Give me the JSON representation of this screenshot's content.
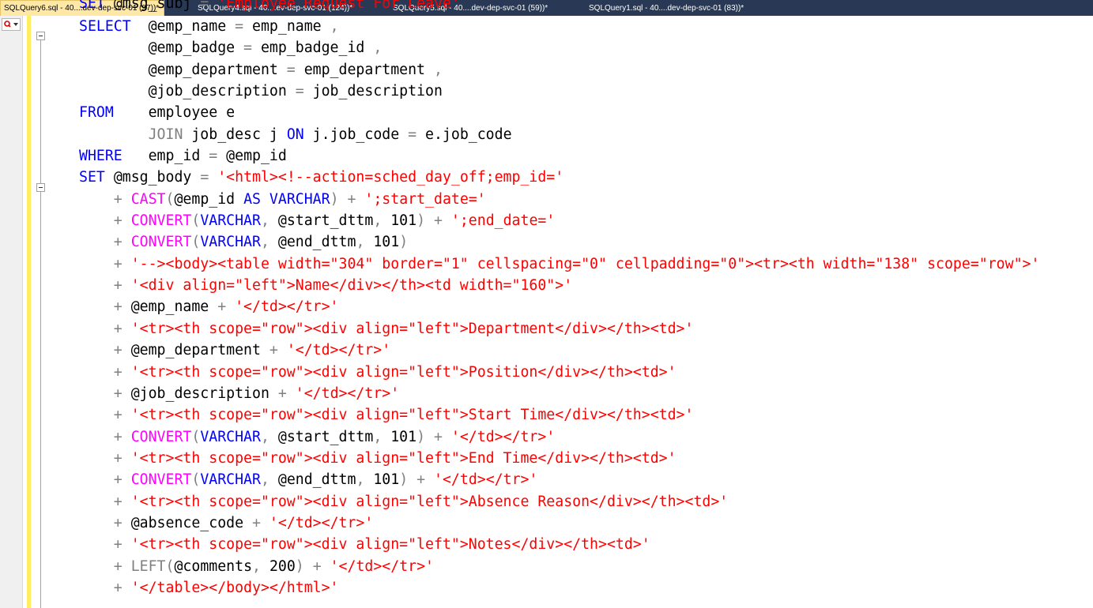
{
  "tabs": [
    {
      "label": "SQLQuery6.sql - 40....dev-dep-svc-01 (97))*",
      "active": true
    },
    {
      "label": "SQLQuery4.sql - 40....ev-dep-svc-01 (124))*",
      "active": false
    },
    {
      "label": "SQLQuery5.sql - 40....dev-dep-svc-01 (59))*",
      "active": false
    },
    {
      "label": "SQLQuery1.sql - 40....dev-dep-svc-01 (83))*",
      "active": false
    }
  ],
  "colors": {
    "keyword": "#0000ff",
    "function": "#ff00ff",
    "string": "#ff0000",
    "operator": "#808080",
    "identifier": "#000000",
    "tab_strip": "#293955",
    "active_tab": "#ffe8a6",
    "change_bar": "#ffee62"
  },
  "icons": {
    "navigation": "navigation-dropdown-icon",
    "fold": "collapse-minus-icon"
  },
  "editor": {
    "partial_top_line": [
      [
        "kw",
        "SET "
      ],
      [
        "id",
        "@msg_subj "
      ],
      [
        "op",
        "= "
      ],
      [
        "str",
        "'Employee Request For Leave'"
      ]
    ],
    "lines": [
      [
        [
          "kw",
          "SELECT  "
        ],
        [
          "id",
          "@emp_name "
        ],
        [
          "op",
          "= "
        ],
        [
          "id",
          "emp_name "
        ],
        [
          "op",
          ","
        ]
      ],
      [
        [
          "id",
          "        @emp_badge "
        ],
        [
          "op",
          "= "
        ],
        [
          "id",
          "emp_badge_id "
        ],
        [
          "op",
          ","
        ]
      ],
      [
        [
          "id",
          "        @emp_department "
        ],
        [
          "op",
          "= "
        ],
        [
          "id",
          "emp_department "
        ],
        [
          "op",
          ","
        ]
      ],
      [
        [
          "id",
          "        @job_description "
        ],
        [
          "op",
          "= "
        ],
        [
          "id",
          "job_description"
        ]
      ],
      [
        [
          "kw",
          "FROM    "
        ],
        [
          "id",
          "employee e"
        ]
      ],
      [
        [
          "op",
          "        JOIN "
        ],
        [
          "id",
          "job_desc j "
        ],
        [
          "kw",
          "ON "
        ],
        [
          "id",
          "j.job_code "
        ],
        [
          "op",
          "= "
        ],
        [
          "id",
          "e.job_code"
        ]
      ],
      [
        [
          "kw",
          "WHERE   "
        ],
        [
          "id",
          "emp_id "
        ],
        [
          "op",
          "= "
        ],
        [
          "id",
          "@emp_id"
        ]
      ],
      [
        [
          "kw",
          "SET "
        ],
        [
          "id",
          "@msg_body "
        ],
        [
          "op",
          "= "
        ],
        [
          "str",
          "'<html><!--action=sched_day_off;emp_id='"
        ]
      ],
      [
        [
          "op",
          "    + "
        ],
        [
          "fn",
          "CAST"
        ],
        [
          "op",
          "("
        ],
        [
          "id",
          "@emp_id "
        ],
        [
          "kw",
          "AS VARCHAR"
        ],
        [
          "op",
          ") + "
        ],
        [
          "str",
          "';start_date='"
        ]
      ],
      [
        [
          "op",
          "    + "
        ],
        [
          "fn",
          "CONVERT"
        ],
        [
          "op",
          "("
        ],
        [
          "kw",
          "VARCHAR"
        ],
        [
          "op",
          ", "
        ],
        [
          "id",
          "@start_dttm"
        ],
        [
          "op",
          ", "
        ],
        [
          "id",
          "101"
        ],
        [
          "op",
          ") + "
        ],
        [
          "str",
          "';end_date='"
        ]
      ],
      [
        [
          "op",
          "    + "
        ],
        [
          "fn",
          "CONVERT"
        ],
        [
          "op",
          "("
        ],
        [
          "kw",
          "VARCHAR"
        ],
        [
          "op",
          ", "
        ],
        [
          "id",
          "@end_dttm"
        ],
        [
          "op",
          ", "
        ],
        [
          "id",
          "101"
        ],
        [
          "op",
          ")"
        ]
      ],
      [
        [
          "op",
          "    + "
        ],
        [
          "str",
          "'--><body><table width=\"304\" border=\"1\" cellspacing=\"0\" cellpadding=\"0\"><tr><th width=\"138\" scope=\"row\">'"
        ]
      ],
      [
        [
          "op",
          "    + "
        ],
        [
          "str",
          "'<div align=\"left\">Name</div></th><td width=\"160\">'"
        ]
      ],
      [
        [
          "op",
          "    + "
        ],
        [
          "id",
          "@emp_name "
        ],
        [
          "op",
          "+ "
        ],
        [
          "str",
          "'</td></tr>'"
        ]
      ],
      [
        [
          "op",
          "    + "
        ],
        [
          "str",
          "'<tr><th scope=\"row\"><div align=\"left\">Department</div></th><td>'"
        ]
      ],
      [
        [
          "op",
          "    + "
        ],
        [
          "id",
          "@emp_department "
        ],
        [
          "op",
          "+ "
        ],
        [
          "str",
          "'</td></tr>'"
        ]
      ],
      [
        [
          "op",
          "    + "
        ],
        [
          "str",
          "'<tr><th scope=\"row\"><div align=\"left\">Position</div></th><td>'"
        ]
      ],
      [
        [
          "op",
          "    + "
        ],
        [
          "id",
          "@job_description "
        ],
        [
          "op",
          "+ "
        ],
        [
          "str",
          "'</td></tr>'"
        ]
      ],
      [
        [
          "op",
          "    + "
        ],
        [
          "str",
          "'<tr><th scope=\"row\"><div align=\"left\">Start Time</div></th><td>'"
        ]
      ],
      [
        [
          "op",
          "    + "
        ],
        [
          "fn",
          "CONVERT"
        ],
        [
          "op",
          "("
        ],
        [
          "kw",
          "VARCHAR"
        ],
        [
          "op",
          ", "
        ],
        [
          "id",
          "@start_dttm"
        ],
        [
          "op",
          ", "
        ],
        [
          "id",
          "101"
        ],
        [
          "op",
          ") + "
        ],
        [
          "str",
          "'</td></tr>'"
        ]
      ],
      [
        [
          "op",
          "    + "
        ],
        [
          "str",
          "'<tr><th scope=\"row\"><div align=\"left\">End Time</div></th><td>'"
        ]
      ],
      [
        [
          "op",
          "    + "
        ],
        [
          "fn",
          "CONVERT"
        ],
        [
          "op",
          "("
        ],
        [
          "kw",
          "VARCHAR"
        ],
        [
          "op",
          ", "
        ],
        [
          "id",
          "@end_dttm"
        ],
        [
          "op",
          ", "
        ],
        [
          "id",
          "101"
        ],
        [
          "op",
          ") + "
        ],
        [
          "str",
          "'</td></tr>'"
        ]
      ],
      [
        [
          "op",
          "    + "
        ],
        [
          "str",
          "'<tr><th scope=\"row\"><div align=\"left\">Absence Reason</div></th><td>'"
        ]
      ],
      [
        [
          "op",
          "    + "
        ],
        [
          "id",
          "@absence_code "
        ],
        [
          "op",
          "+ "
        ],
        [
          "str",
          "'</td></tr>'"
        ]
      ],
      [
        [
          "op",
          "    + "
        ],
        [
          "str",
          "'<tr><th scope=\"row\"><div align=\"left\">Notes</div></th><td>'"
        ]
      ],
      [
        [
          "op",
          "    + "
        ],
        [
          "op",
          "LEFT"
        ],
        [
          "op",
          "("
        ],
        [
          "id",
          "@comments"
        ],
        [
          "op",
          ", "
        ],
        [
          "id",
          "200"
        ],
        [
          "op",
          ") + "
        ],
        [
          "str",
          "'</td></tr>'"
        ]
      ],
      [
        [
          "op",
          "    + "
        ],
        [
          "str",
          "'</table></body></html>'"
        ]
      ]
    ]
  }
}
